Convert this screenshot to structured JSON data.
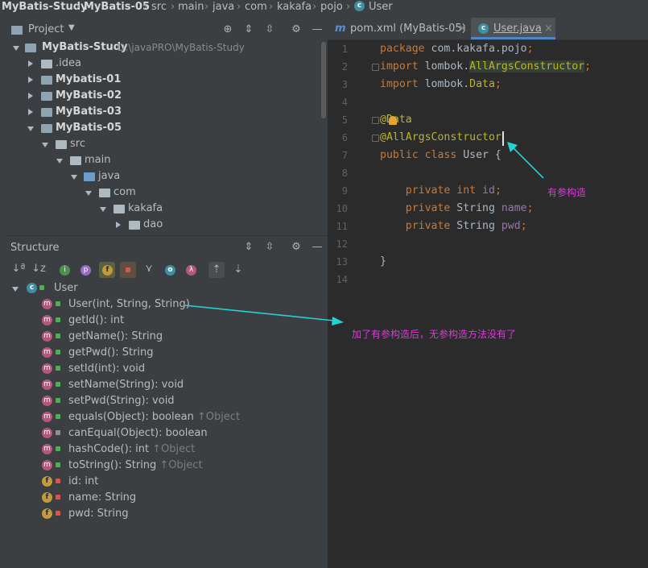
{
  "breadcrumb": [
    {
      "label": "MyBatis-Study",
      "bold": true
    },
    {
      "label": "MyBatis-05",
      "bold": true
    },
    {
      "label": "src"
    },
    {
      "label": "main"
    },
    {
      "label": "java"
    },
    {
      "label": "com"
    },
    {
      "label": "kakafa"
    },
    {
      "label": "pojo"
    },
    {
      "label": "User"
    }
  ],
  "project_panel": {
    "title": "Project",
    "root": {
      "name": "MyBatis-Study",
      "path": "D:\\javaPRO\\MyBatis-Study"
    },
    "items": [
      ".idea",
      "Mybatis-01",
      "MyBatis-02",
      "MyBatis-03",
      "MyBatis-05",
      "src",
      "main",
      "java",
      "com",
      "kakafa",
      "dao"
    ]
  },
  "structure_panel": {
    "title": "Structure",
    "class_name": "User",
    "members": [
      {
        "text": "User(int, String, String)",
        "kind": "m",
        "access": "public",
        "inherited": ""
      },
      {
        "text": "getId(): int",
        "kind": "m",
        "access": "public",
        "inherited": ""
      },
      {
        "text": "getName(): String",
        "kind": "m",
        "access": "public",
        "inherited": ""
      },
      {
        "text": "getPwd(): String",
        "kind": "m",
        "access": "public",
        "inherited": ""
      },
      {
        "text": "setId(int): void",
        "kind": "m",
        "access": "public",
        "inherited": ""
      },
      {
        "text": "setName(String): void",
        "kind": "m",
        "access": "public",
        "inherited": ""
      },
      {
        "text": "setPwd(String): void",
        "kind": "m",
        "access": "public",
        "inherited": ""
      },
      {
        "text": "equals(Object): boolean",
        "kind": "m",
        "access": "public",
        "inherited": "↑Object"
      },
      {
        "text": "canEqual(Object): boolean",
        "kind": "m",
        "access": "protected",
        "inherited": ""
      },
      {
        "text": "hashCode(): int",
        "kind": "m",
        "access": "public",
        "inherited": "↑Object"
      },
      {
        "text": "toString(): String",
        "kind": "m",
        "access": "public",
        "inherited": "↑Object"
      },
      {
        "text": "id: int",
        "kind": "f",
        "access": "private",
        "inherited": ""
      },
      {
        "text": "name: String",
        "kind": "f",
        "access": "private",
        "inherited": ""
      },
      {
        "text": "pwd: String",
        "kind": "f",
        "access": "private",
        "inherited": ""
      }
    ]
  },
  "editor": {
    "tabs": [
      {
        "icon": "m",
        "label": "pom.xml (MyBatis-05)",
        "active": false
      },
      {
        "icon": "c",
        "label": "User.java",
        "active": true
      }
    ],
    "line_numbers": [
      "1",
      "2",
      "3",
      "4",
      "5",
      "6",
      "7",
      "8",
      "9",
      "10",
      "11",
      "12",
      "13",
      "14"
    ],
    "lines": [
      {
        "n": "1",
        "segments": [
          {
            "t": "package ",
            "c": "kw"
          },
          {
            "t": "com.kakafa.pojo",
            "c": ""
          },
          {
            "t": ";",
            "c": "kw"
          }
        ]
      },
      {
        "n": "2",
        "segments": [
          {
            "t": "import ",
            "c": "kw"
          },
          {
            "t": "lombok.",
            "c": ""
          },
          {
            "t": "AllArgsConstructor",
            "c": "hl"
          },
          {
            "t": ";",
            "c": "kw"
          }
        ]
      },
      {
        "n": "3",
        "segments": [
          {
            "t": "import ",
            "c": "kw"
          },
          {
            "t": "lombok.",
            "c": ""
          },
          {
            "t": "Data",
            "c": "ann"
          },
          {
            "t": ";",
            "c": "kw"
          }
        ]
      },
      {
        "n": "4",
        "segments": []
      },
      {
        "n": "5",
        "segments": [
          {
            "t": "@",
            "c": "ann"
          },
          {
            "t": "Data",
            "c": "ann"
          }
        ]
      },
      {
        "n": "6",
        "segments": [
          {
            "t": "@AllArgsConstructor",
            "c": "ann"
          }
        ]
      },
      {
        "n": "7",
        "segments": [
          {
            "t": "public class ",
            "c": "kw"
          },
          {
            "t": "User {",
            "c": ""
          }
        ]
      },
      {
        "n": "8",
        "segments": []
      },
      {
        "n": "9",
        "segments": [
          {
            "t": "    private int ",
            "c": "kw"
          },
          {
            "t": "id",
            "c": "field"
          },
          {
            "t": ";",
            "c": "kw"
          }
        ]
      },
      {
        "n": "10",
        "segments": [
          {
            "t": "    private ",
            "c": "kw"
          },
          {
            "t": "String ",
            "c": ""
          },
          {
            "t": "name",
            "c": "field"
          },
          {
            "t": ";",
            "c": "kw"
          }
        ]
      },
      {
        "n": "11",
        "segments": [
          {
            "t": "    private ",
            "c": "kw"
          },
          {
            "t": "String ",
            "c": ""
          },
          {
            "t": "pwd",
            "c": "field"
          },
          {
            "t": ";",
            "c": "kw"
          }
        ]
      },
      {
        "n": "12",
        "segments": []
      },
      {
        "n": "13",
        "segments": [
          {
            "t": "}",
            "c": ""
          }
        ]
      },
      {
        "n": "14",
        "segments": []
      }
    ]
  },
  "annotations": {
    "note_constructor": "有参构造",
    "note_structure": "加了有参构造后，无参构造方法没有了"
  },
  "colors": {
    "keyword": "#cc7832",
    "annotation": "#bbb529",
    "field": "#9876aa",
    "note": "#e036e0",
    "arrow": "#22d3d3"
  }
}
